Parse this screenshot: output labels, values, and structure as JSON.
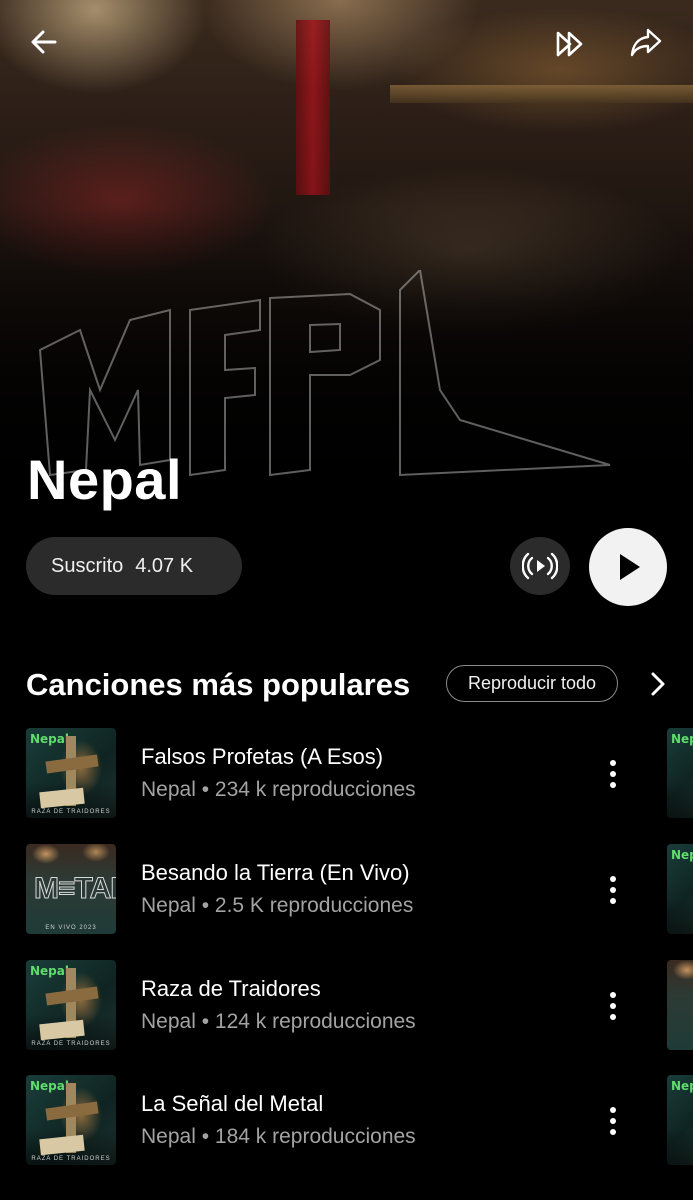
{
  "header": {
    "back_icon": "arrow-left-icon",
    "queue_icon": "double-chevron-right-icon",
    "share_icon": "share-arrow-icon"
  },
  "artist": {
    "name": "Nepal",
    "subscribe_label": "Suscrito",
    "subscriber_count": "4.07 K",
    "radio_icon": "radio-broadcast-icon",
    "play_icon": "play-icon"
  },
  "popular": {
    "title": "Canciones más populares",
    "play_all_label": "Reproducir todo",
    "more_icon": "chevron-right-icon",
    "songs": [
      {
        "title": "Falsos Profetas (A Esos)",
        "meta": "Nepal • 234 k reproducciones",
        "cover": "raza-de-traidores",
        "cover_caption": "RAZA DE TRAIDORES"
      },
      {
        "title": "Besando la Tierra (En Vivo)",
        "meta": "Nepal • 2.5 K reproducciones",
        "cover": "en-vivo-2023",
        "cover_caption": "EN VIVO 2023"
      },
      {
        "title": "Raza de Traidores",
        "meta": "Nepal • 124 k reproducciones",
        "cover": "raza-de-traidores",
        "cover_caption": "RAZA DE TRAIDORES"
      },
      {
        "title": "La Señal del Metal",
        "meta": "Nepal • 184 k reproducciones",
        "cover": "raza-de-traidores",
        "cover_caption": "RAZA DE TRAIDORES"
      }
    ]
  },
  "colors": {
    "background": "#000000",
    "pill": "#2b2b2b",
    "secondary_text": "#a3a3a3",
    "play_button": "#f2f2f2"
  }
}
